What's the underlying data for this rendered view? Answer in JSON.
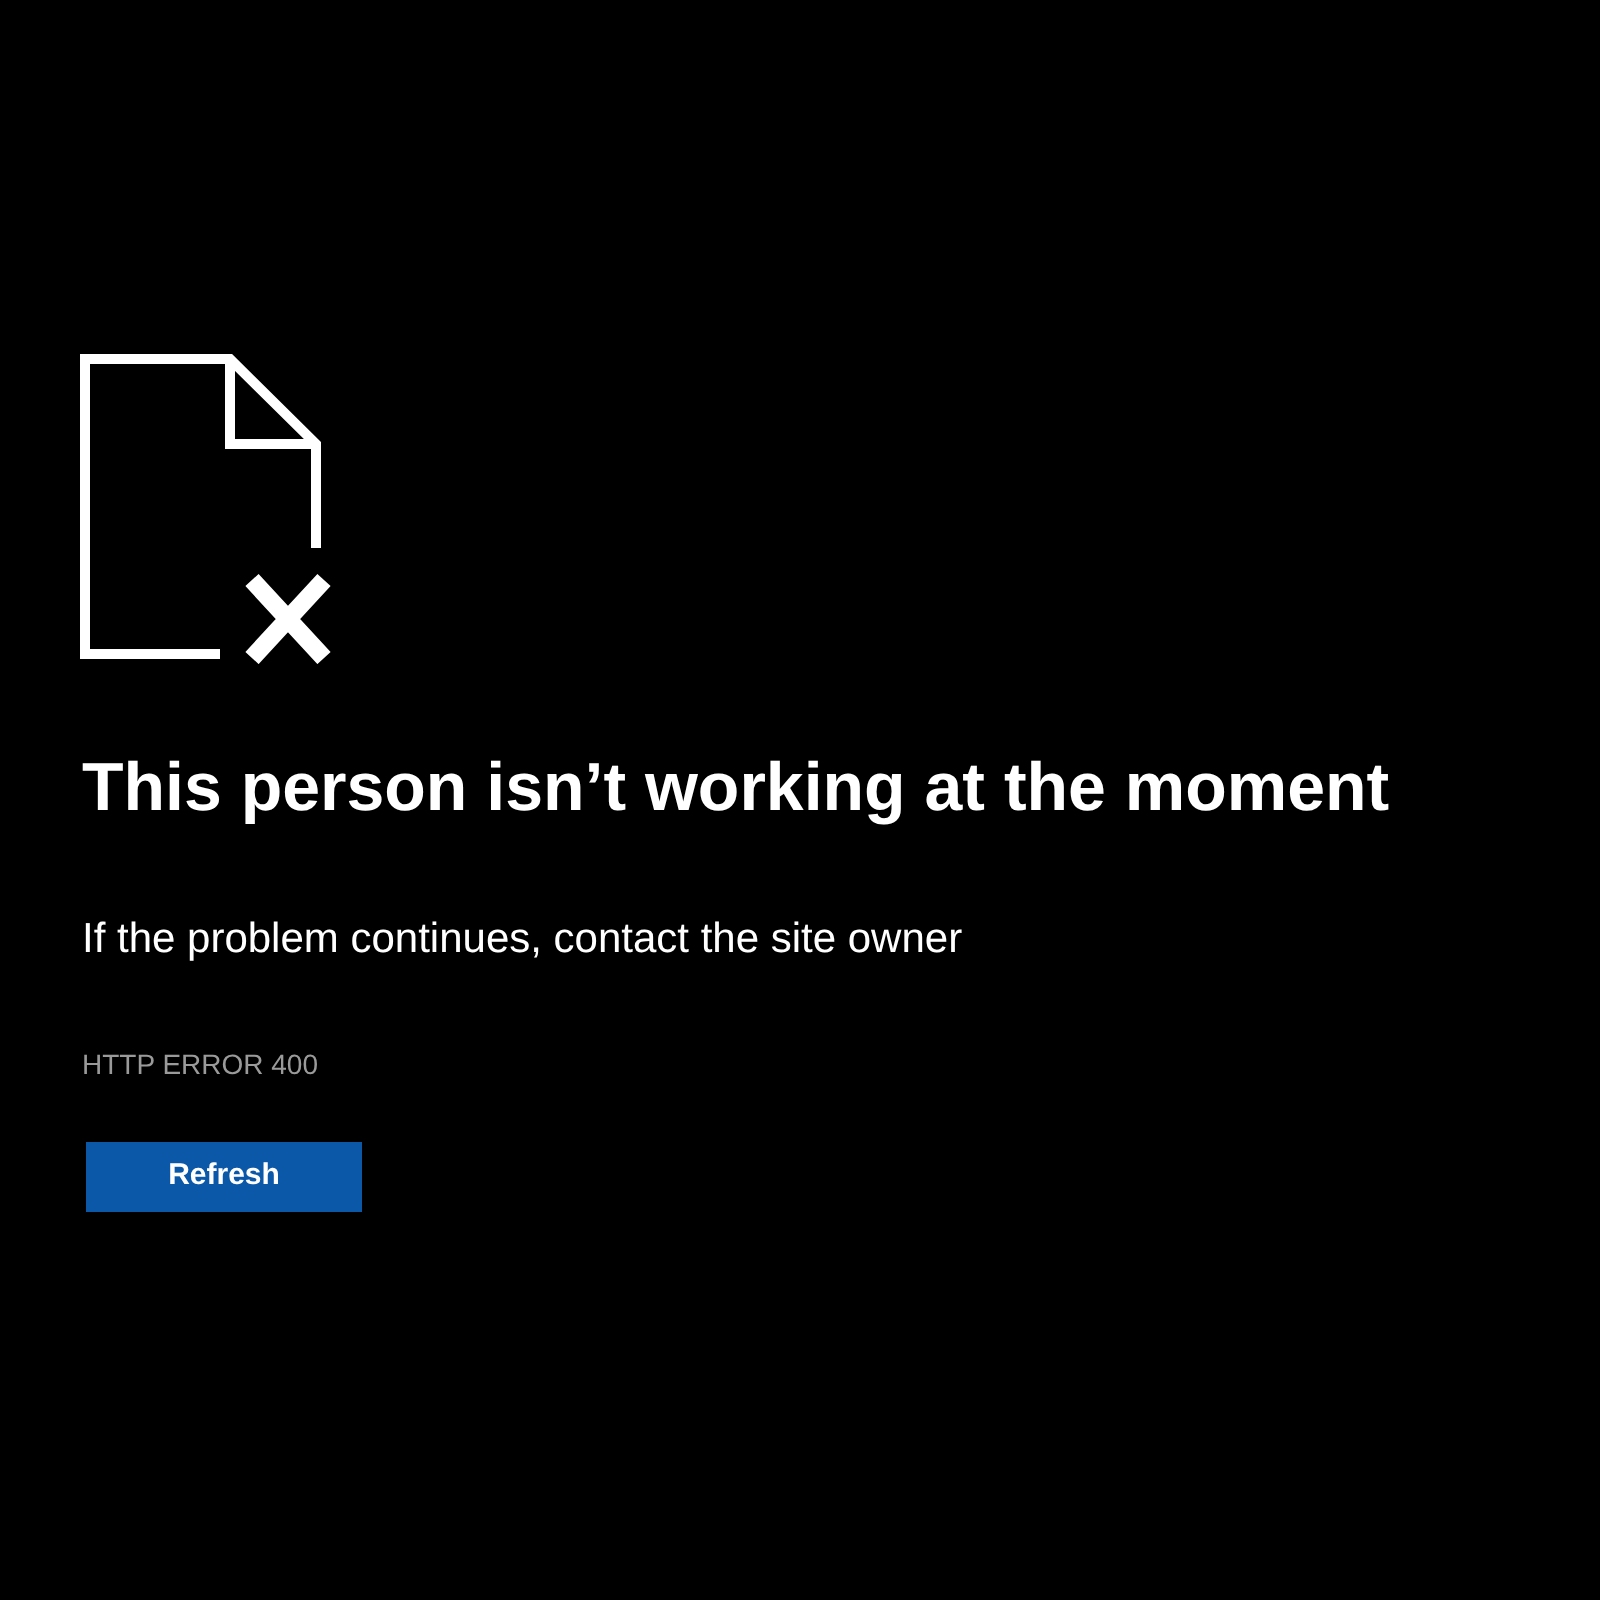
{
  "error": {
    "title": "This person isn’t working at the moment",
    "message": "If the problem continues, contact the site owner",
    "code": "HTTP ERROR 400"
  },
  "buttons": [
    {
      "label": "Refresh",
      "kind": "primary"
    }
  ]
}
